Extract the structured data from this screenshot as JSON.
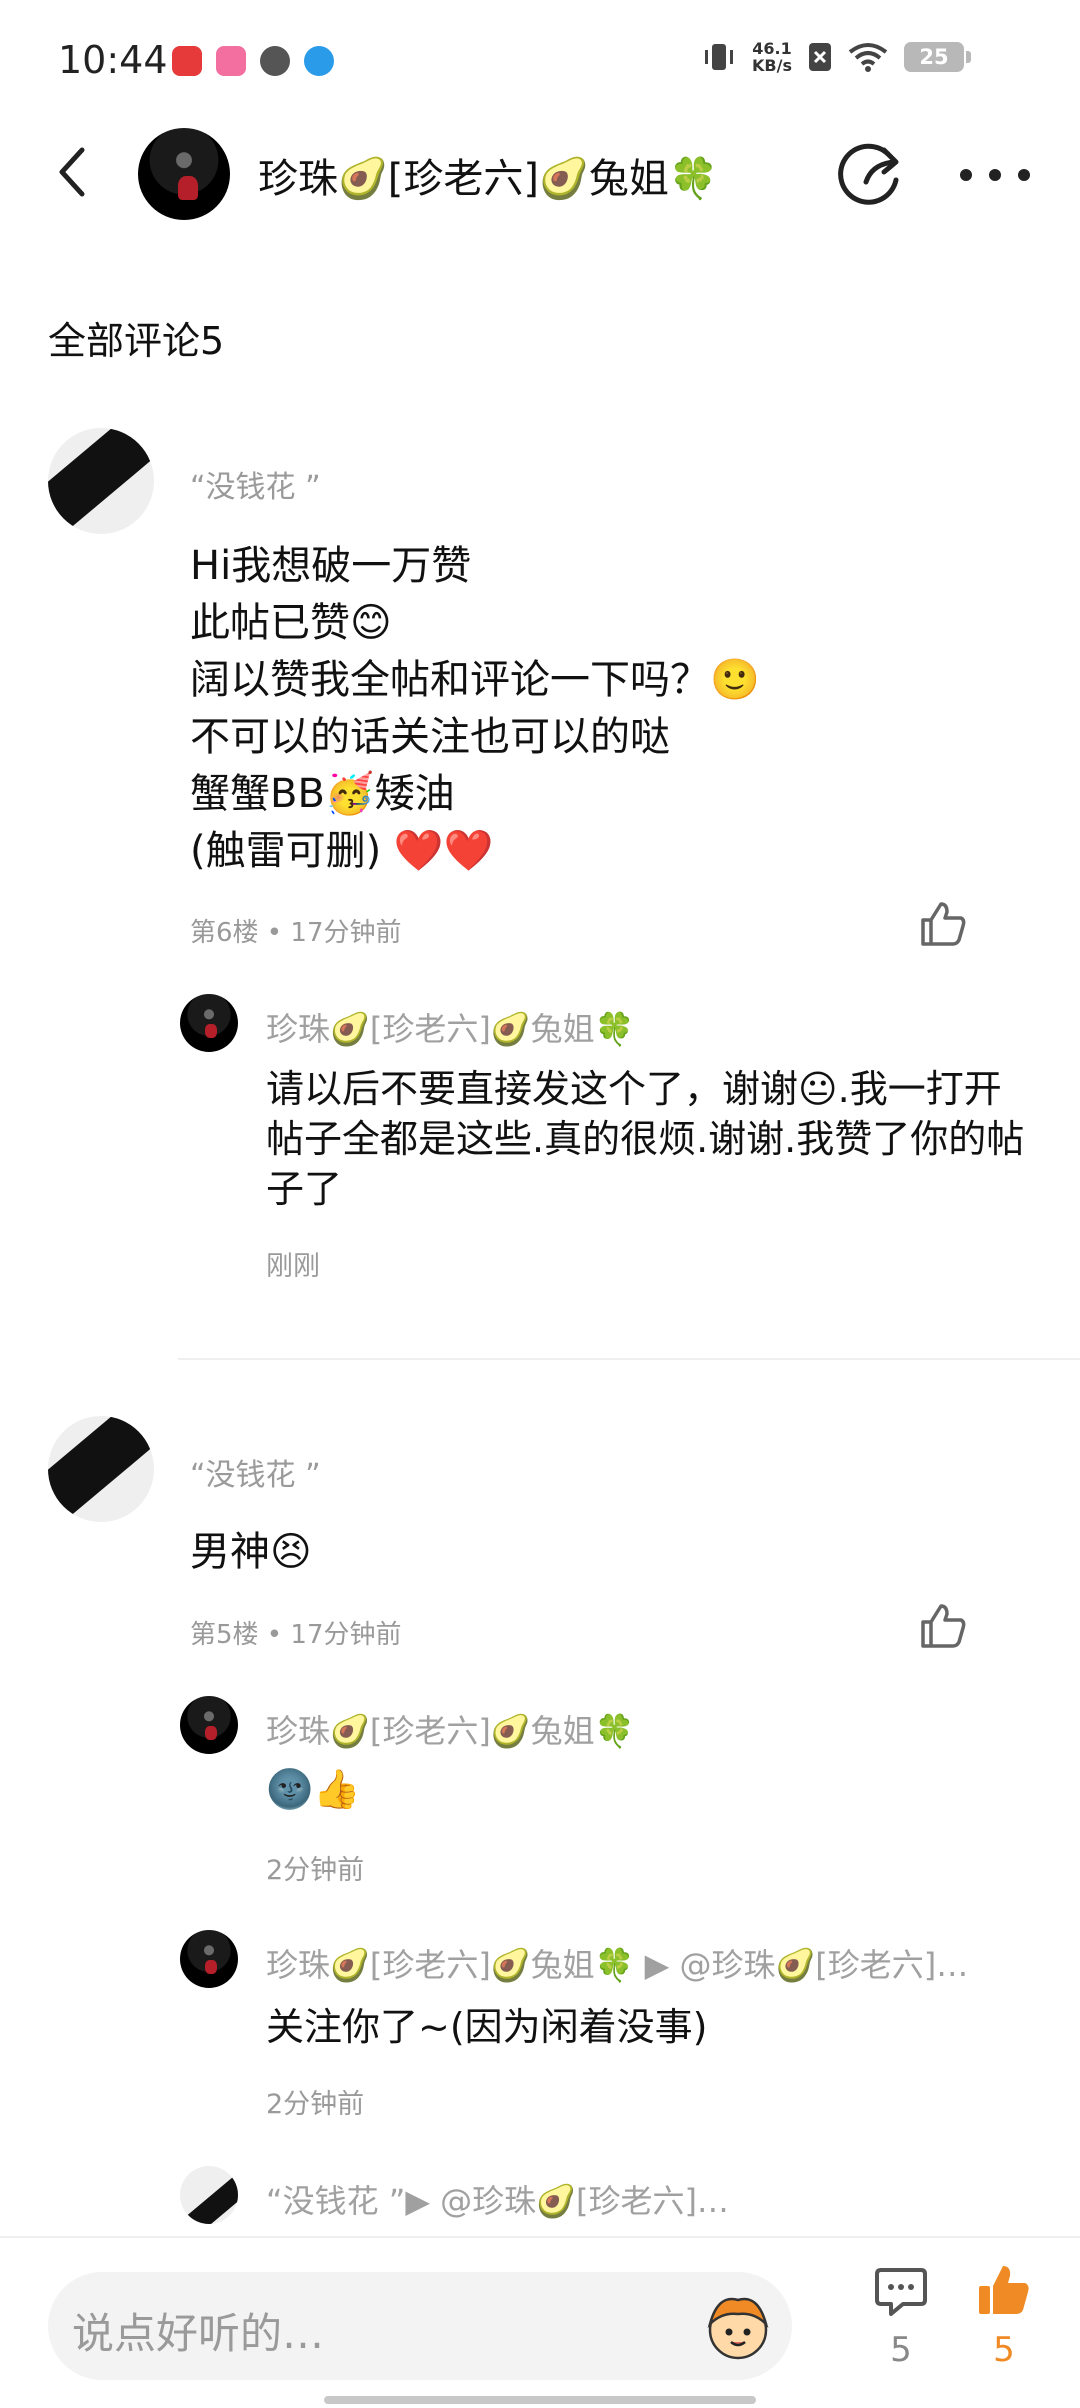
{
  "status_bar": {
    "time": "10:44",
    "net_speed_value": "46.1",
    "net_speed_unit": "KB/s",
    "battery": "25"
  },
  "header": {
    "title": "珍珠🥑[珍老六]🥑兔姐🍀"
  },
  "section_title": "全部评论5",
  "comments": [
    {
      "username": "“没钱花 ”",
      "content": "Hi我想破一万赞\n此帖已赞😊\n阔以赞我全帖和评论一下吗？🙂\n不可以的话关注也可以的哒\n蟹蟹BB🥳矮油\n(触雷可删) ❤️❤️",
      "meta": "第6楼 • 17分钟前",
      "replies": [
        {
          "username": "珍珠🥑[珍老六]🥑兔姐🍀",
          "text": "请以后不要直接发这个了，谢谢😐.我一打开帖子全都是这些.真的很烦.谢谢.我赞了你的帖子了",
          "time": "刚刚"
        }
      ]
    },
    {
      "username": "“没钱花 ”",
      "content": "男神😣",
      "meta": "第5楼 • 17分钟前",
      "replies": [
        {
          "username": "珍珠🥑[珍老六]🥑兔姐🍀",
          "text": "🌚👍",
          "time": "2分钟前"
        },
        {
          "username": "珍珠🥑[珍老六]🥑兔姐🍀 ▶ @珍珠🥑[珍老六]…",
          "text": "关注你了~(因为闲着没事)",
          "time": "2分钟前"
        },
        {
          "username": "“没钱花 ”▶ @珍珠🥑[珍老六]…"
        }
      ]
    }
  ],
  "bottom_bar": {
    "input_placeholder": "说点好听的…",
    "comment_count": "5",
    "like_count": "5"
  },
  "colors": {
    "accent": "#f08a24",
    "text": "#111111",
    "muted": "#9a9a9a"
  }
}
